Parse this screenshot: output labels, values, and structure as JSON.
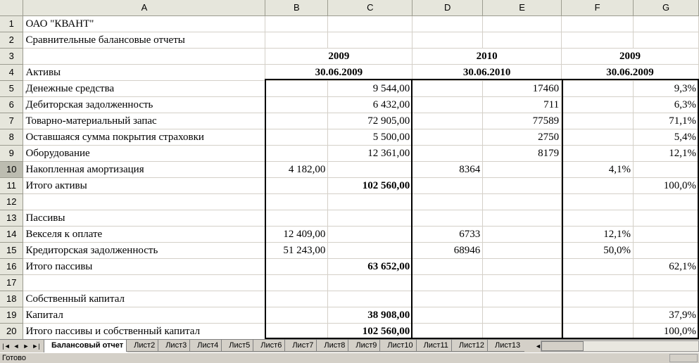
{
  "columns": [
    "A",
    "B",
    "C",
    "D",
    "E",
    "F",
    "G"
  ],
  "header_row1": {
    "b_c": "2009",
    "d_e": "2010",
    "f_g": "2009"
  },
  "header_row2": {
    "b_c": "30.06.2009",
    "d_e": "30.06.2010",
    "f_g": "30.06.2009"
  },
  "rows": [
    {
      "n": "1",
      "a": "ОАО \"КВАНТ\"",
      "b": "",
      "c": "",
      "d": "",
      "e": "",
      "f": "",
      "g": ""
    },
    {
      "n": "2",
      "a": "Сравнительные балансовые отчеты",
      "b": "",
      "c": "",
      "d": "",
      "e": "",
      "f": "",
      "g": ""
    },
    {
      "n": "3",
      "a": "",
      "b": "",
      "c": "",
      "d": "",
      "e": "",
      "f": "",
      "g": ""
    },
    {
      "n": "4",
      "a": "Активы",
      "b": "",
      "c": "",
      "d": "",
      "e": "",
      "f": "",
      "g": ""
    },
    {
      "n": "5",
      "a": "Денежные средства",
      "b": "",
      "c": "9 544,00",
      "d": "",
      "e": "17460",
      "f": "",
      "g": "9,3%"
    },
    {
      "n": "6",
      "a": "Дебиторская задолженность",
      "b": "",
      "c": "6 432,00",
      "d": "",
      "e": "711",
      "f": "",
      "g": "6,3%"
    },
    {
      "n": "7",
      "a": "Товарно-материальный запас",
      "b": "",
      "c": "72 905,00",
      "d": "",
      "e": "77589",
      "f": "",
      "g": "71,1%"
    },
    {
      "n": "8",
      "a": "Оставшаяся сумма покрытия страховки",
      "b": "",
      "c": "5 500,00",
      "d": "",
      "e": "2750",
      "f": "",
      "g": "5,4%"
    },
    {
      "n": "9",
      "a": "Оборудование",
      "b": "",
      "c": "12 361,00",
      "d": "",
      "e": "8179",
      "f": "",
      "g": "12,1%"
    },
    {
      "n": "10",
      "a": "Накопленная амортизация",
      "b": "4 182,00",
      "c": "",
      "d": "8364",
      "e": "",
      "f": "4,1%",
      "g": ""
    },
    {
      "n": "11",
      "a": "Итого активы",
      "b": "",
      "c": "102 560,00",
      "d": "",
      "e": "",
      "f": "",
      "g": "100,0%"
    },
    {
      "n": "12",
      "a": "",
      "b": "",
      "c": "",
      "d": "",
      "e": "",
      "f": "",
      "g": ""
    },
    {
      "n": "13",
      "a": "Пассивы",
      "b": "",
      "c": "",
      "d": "",
      "e": "",
      "f": "",
      "g": ""
    },
    {
      "n": "14",
      "a": "Векселя к оплате",
      "b": "12 409,00",
      "c": "",
      "d": "6733",
      "e": "",
      "f": "12,1%",
      "g": ""
    },
    {
      "n": "15",
      "a": "Кредиторская задолженность",
      "b": "51 243,00",
      "c": "",
      "d": "68946",
      "e": "",
      "f": "50,0%",
      "g": ""
    },
    {
      "n": "16",
      "a": "Итого пассивы",
      "b": "",
      "c": "63 652,00",
      "d": "",
      "e": "",
      "f": "",
      "g": "62,1%"
    },
    {
      "n": "17",
      "a": "",
      "b": "",
      "c": "",
      "d": "",
      "e": "",
      "f": "",
      "g": ""
    },
    {
      "n": "18",
      "a": "Собственный капитал",
      "b": "",
      "c": "",
      "d": "",
      "e": "",
      "f": "",
      "g": ""
    },
    {
      "n": "19",
      "a": "Капитал",
      "b": "",
      "c": "38 908,00",
      "d": "",
      "e": "",
      "f": "",
      "g": "37,9%"
    },
    {
      "n": "20",
      "a": "Итого пассивы и собственный капитал",
      "b": "",
      "c": "102 560,00",
      "d": "",
      "e": "",
      "f": "",
      "g": "100,0%"
    }
  ],
  "tabs": [
    "Балансовый отчет",
    "Лист2",
    "Лист3",
    "Лист4",
    "Лист5",
    "Лист6",
    "Лист7",
    "Лист8",
    "Лист9",
    "Лист10",
    "Лист11",
    "Лист12",
    "Лист13"
  ],
  "status": "Готово"
}
